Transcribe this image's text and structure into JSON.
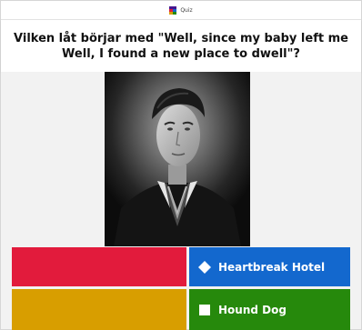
{
  "app": {
    "title": "Quiz",
    "icon": "quiz-app-icon"
  },
  "question": {
    "text": "Vilken låt börjar med \"Well, since my baby left me Well, I found a new place to dwell\"?"
  },
  "media": {
    "image": "portrait-photo"
  },
  "answers": [
    {
      "color": "#e21b3c",
      "shape": "triangle-icon",
      "label": ""
    },
    {
      "color": "#1368ce",
      "shape": "diamond-icon",
      "label": "Heartbreak Hotel"
    },
    {
      "color": "#d89e00",
      "shape": "circle-icon",
      "label": ""
    },
    {
      "color": "#26890c",
      "shape": "square-icon",
      "label": "Hound Dog"
    }
  ]
}
